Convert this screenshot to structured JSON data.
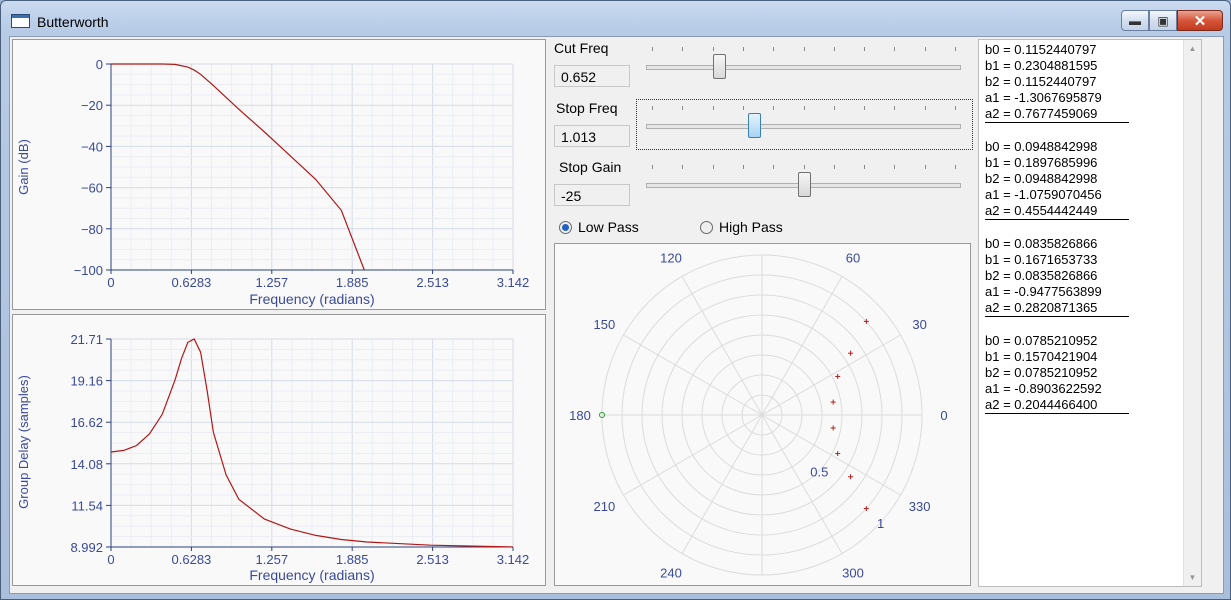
{
  "window": {
    "title": "Butterworth"
  },
  "gain_plot": {
    "ylabel": "Gain (dB)",
    "xlabel": "Frequency (radians)",
    "yticks": [
      "0",
      "−20",
      "−40",
      "−60",
      "−80",
      "−100"
    ],
    "xticks": [
      "0",
      "0.6283",
      "1.257",
      "1.885",
      "2.513",
      "3.142"
    ]
  },
  "delay_plot": {
    "ylabel": "Group Delay (samples)",
    "xlabel": "Frequency (radians)",
    "yticks": [
      "21.71",
      "19.16",
      "16.62",
      "14.08",
      "11.54",
      "8.992"
    ],
    "xticks": [
      "0",
      "0.6283",
      "1.257",
      "1.885",
      "2.513",
      "3.142"
    ]
  },
  "controls": {
    "cut_freq": {
      "label": "Cut Freq",
      "value": "0.652",
      "position": 0.222
    },
    "stop_freq": {
      "label": "Stop Freq",
      "value": "1.013",
      "position": 0.335
    },
    "stop_gain": {
      "label": "Stop Gain",
      "value": "-25",
      "position": 0.5
    },
    "low_pass_label": "Low Pass",
    "high_pass_label": "High Pass",
    "filter_type": "low_pass"
  },
  "polar_plot": {
    "angle_labels": [
      "0",
      "30",
      "60",
      "120",
      "150",
      "180",
      "210",
      "240",
      "300",
      "330"
    ],
    "radius_labels": [
      "0.5",
      "1"
    ],
    "zero_color": "#2a9a2a",
    "pole_color": "#b02020"
  },
  "coefficients": [
    {
      "b0": "b0 = 0.1152440797",
      "b1": "b1 = 0.2304881595",
      "b2": "b2 = 0.1152440797",
      "a1": "a1 = -1.3067695879",
      "a2": "a2 = 0.7677459069"
    },
    {
      "b0": "b0 = 0.0948842998",
      "b1": "b1 = 0.1897685996",
      "b2": "b2 = 0.0948842998",
      "a1": "a1 = -1.0759070456",
      "a2": "a2 = 0.4554442449"
    },
    {
      "b0": "b0 = 0.0835826866",
      "b1": "b1 = 0.1671653733",
      "b2": "b2 = 0.0835826866",
      "a1": "a1 = -0.9477563899",
      "a2": "a2 = 0.2820871365"
    },
    {
      "b0": "b0 = 0.0785210952",
      "b1": "b1 = 0.1570421904",
      "b2": "b2 = 0.0785210952",
      "a1": "a1 = -0.8903622592",
      "a2": "a2 = 0.2044466400"
    }
  ],
  "chart_data": [
    {
      "type": "line",
      "xlabel": "Frequency (radians)",
      "ylabel": "Gain (dB)",
      "xlim": [
        0,
        3.142
      ],
      "ylim": [
        -100,
        0
      ],
      "series": [
        {
          "x": [
            0,
            0.2,
            0.4,
            0.5,
            0.6,
            0.652,
            0.7,
            0.8,
            1.0,
            1.2,
            1.4,
            1.6,
            1.8,
            1.98
          ],
          "y": [
            0,
            0,
            0,
            -0.2,
            -1.5,
            -3,
            -5,
            -10.5,
            -22,
            -33,
            -44.5,
            -56,
            -71,
            -100
          ]
        }
      ]
    },
    {
      "type": "line",
      "xlabel": "Frequency (radians)",
      "ylabel": "Group Delay (samples)",
      "xlim": [
        0,
        3.142
      ],
      "ylim": [
        8.992,
        21.71
      ],
      "series": [
        {
          "x": [
            0,
            0.1,
            0.2,
            0.3,
            0.4,
            0.5,
            0.55,
            0.6,
            0.65,
            0.7,
            0.75,
            0.8,
            0.9,
            1.0,
            1.2,
            1.4,
            1.6,
            1.8,
            2.0,
            2.5,
            3.142
          ],
          "y": [
            14.8,
            14.9,
            15.2,
            15.9,
            17.1,
            19.2,
            20.5,
            21.5,
            21.71,
            20.9,
            18.6,
            16.0,
            13.4,
            11.9,
            10.7,
            10.1,
            9.7,
            9.45,
            9.3,
            9.1,
            8.992
          ]
        }
      ]
    },
    {
      "type": "scatter",
      "title": "",
      "points": [
        {
          "kind": "zero",
          "r": 1.0,
          "angle": 180
        },
        {
          "kind": "pole",
          "r": 0.876,
          "angle": 41.9
        },
        {
          "kind": "pole",
          "r": 0.876,
          "angle": -41.9
        },
        {
          "kind": "pole",
          "r": 0.675,
          "angle": 34.9
        },
        {
          "kind": "pole",
          "r": 0.675,
          "angle": -34.9
        },
        {
          "kind": "pole",
          "r": 0.531,
          "angle": 27.0
        },
        {
          "kind": "pole",
          "r": 0.531,
          "angle": -27.0
        },
        {
          "kind": "pole",
          "r": 0.452,
          "angle": 10.3
        },
        {
          "kind": "pole",
          "r": 0.452,
          "angle": -10.3
        }
      ]
    }
  ]
}
